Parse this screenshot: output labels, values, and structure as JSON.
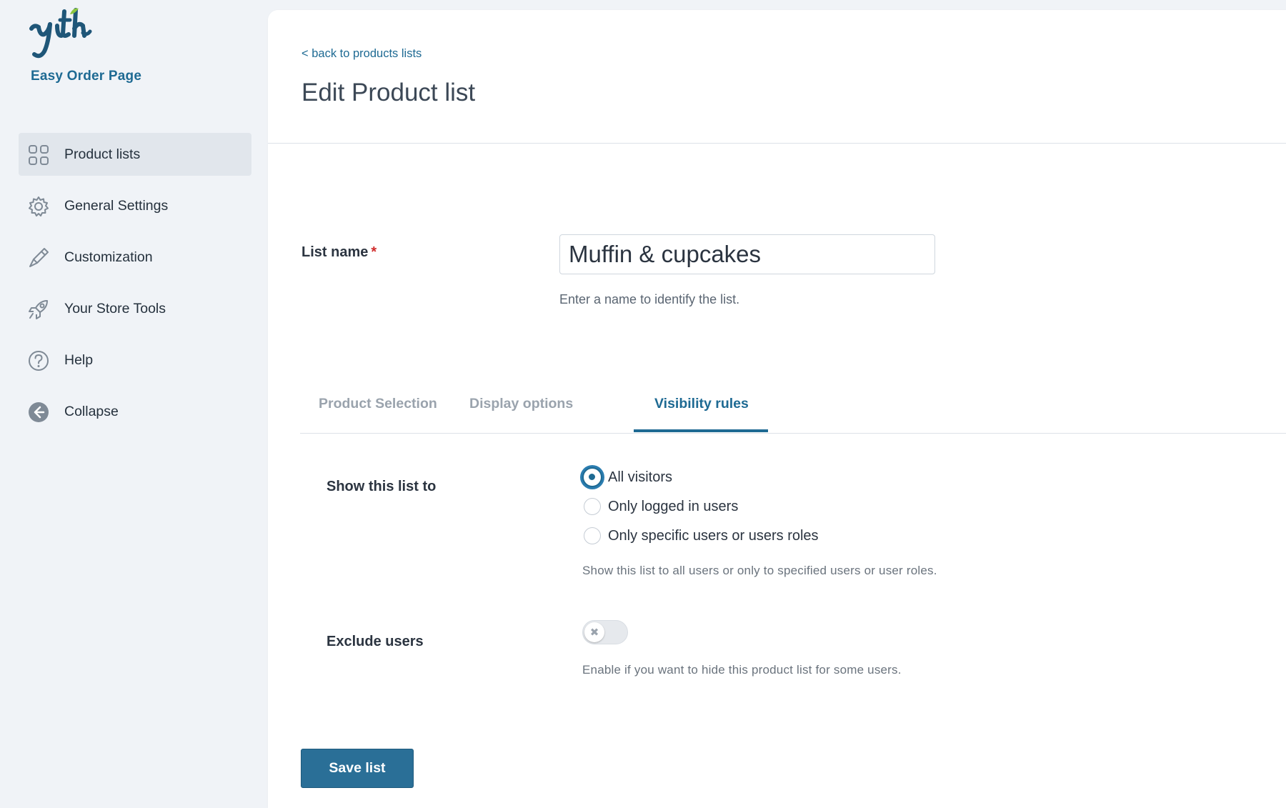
{
  "sidebar": {
    "plugin_name": "Easy Order Page",
    "items": [
      {
        "label": "Product lists",
        "icon": "grid-icon",
        "active": true
      },
      {
        "label": "General Settings",
        "icon": "gear-icon",
        "active": false
      },
      {
        "label": "Customization",
        "icon": "brush-icon",
        "active": false
      },
      {
        "label": "Your Store Tools",
        "icon": "rocket-icon",
        "active": false
      },
      {
        "label": "Help",
        "icon": "question-icon",
        "active": false
      },
      {
        "label": "Collapse",
        "icon": "collapse-arrow-icon",
        "active": false
      }
    ]
  },
  "header": {
    "back_link": "< back to products lists",
    "title": "Edit Product list"
  },
  "list_name": {
    "label": "List name",
    "required_mark": "*",
    "value": "Muffin & cupcakes",
    "help": "Enter a name to identify the list."
  },
  "tabs": [
    {
      "label": "Product Selection",
      "active": false
    },
    {
      "label": "Display options",
      "active": false
    },
    {
      "label": "Visibility rules",
      "active": true
    }
  ],
  "visibility": {
    "label": "Show this list to",
    "options": [
      {
        "label": "All visitors",
        "checked": true
      },
      {
        "label": "Only logged in users",
        "checked": false
      },
      {
        "label": "Only specific users or users roles",
        "checked": false
      }
    ],
    "help": "Show this list to all users or only to specified users or user roles."
  },
  "exclude_users": {
    "label": "Exclude users",
    "enabled": false,
    "toggle_glyph": "✖",
    "help": "Enable if you want to hide this product list for some users."
  },
  "save_button": "Save list",
  "colors": {
    "accent": "#1e6a93",
    "button": "#2a6f97",
    "logo_leaf": "#8cc63f"
  }
}
